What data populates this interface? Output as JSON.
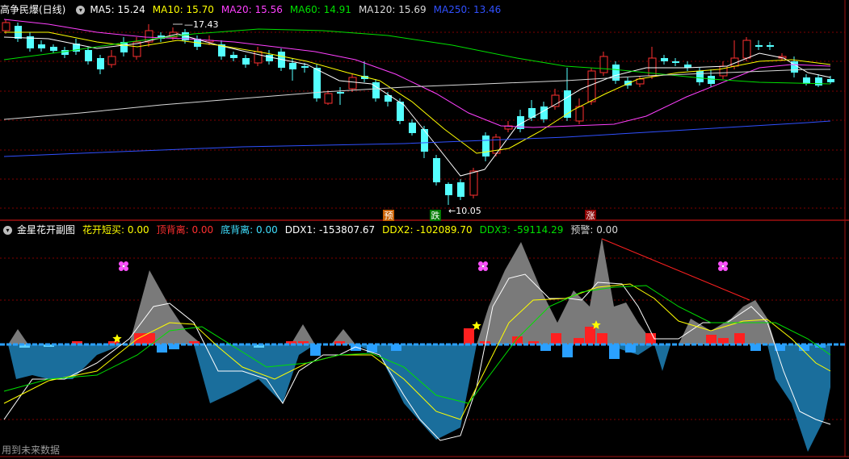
{
  "main_legend": {
    "title": "高争民爆(日线)",
    "items": [
      {
        "text": "MA5: 15.24",
        "color": "#ffffff"
      },
      {
        "text": "MA10: 15.70",
        "color": "#ffff00"
      },
      {
        "text": "MA20: 15.56",
        "color": "#ff40ff"
      },
      {
        "text": "MA60: 14.91",
        "color": "#00e000"
      },
      {
        "text": "MA120: 15.69",
        "color": "#d8d8d8"
      },
      {
        "text": "MA250: 13.46",
        "color": "#3050ff"
      }
    ]
  },
  "sub_legend": {
    "title": "金星花开副图",
    "items": [
      {
        "text": "花开短买: 0.00",
        "color": "#ffff00"
      },
      {
        "text": "顶背离: 0.00",
        "color": "#ff3030"
      },
      {
        "text": "底背离: 0.00",
        "color": "#40e0ff"
      },
      {
        "text": "DDX1: -153807.67",
        "color": "#ffffff"
      },
      {
        "text": "DDX2: -102089.70",
        "color": "#ffff00"
      },
      {
        "text": "DDX3: -59114.29",
        "color": "#00e000"
      },
      {
        "text": "预警: 0.00",
        "color": "#d8d8d8"
      }
    ]
  },
  "annotations": {
    "high_label": "17.43",
    "low_label": "10.05",
    "tag_yu": "预",
    "tag_die": "跌",
    "tag_zhang": "涨"
  },
  "footer_note": "用到未来数据",
  "colors": {
    "up": "#ff3030",
    "down": "#54ffff",
    "grid": "#800000",
    "blue_area": "#1a6e9c",
    "gray_area": "#7a7a7a"
  },
  "chart_data": [
    {
      "type": "candlestick",
      "series": [
        {
          "name": "MA5",
          "value": 15.24
        },
        {
          "name": "MA10",
          "value": 15.7
        },
        {
          "name": "MA20",
          "value": 15.56
        },
        {
          "name": "MA60",
          "value": 14.91
        },
        {
          "name": "MA120",
          "value": 15.69
        },
        {
          "name": "MA250",
          "value": 13.46
        }
      ],
      "annotations": {
        "high": 17.43,
        "low": 10.05
      }
    },
    {
      "type": "area",
      "series": [
        {
          "name": "花开短买",
          "value": 0.0
        },
        {
          "name": "顶背离",
          "value": 0.0
        },
        {
          "name": "底背离",
          "value": 0.0
        },
        {
          "name": "DDX1",
          "value": -153807.67
        },
        {
          "name": "DDX2",
          "value": -102089.7
        },
        {
          "name": "DDX3",
          "value": -59114.29
        },
        {
          "name": "预警",
          "value": 0.0
        }
      ]
    }
  ]
}
